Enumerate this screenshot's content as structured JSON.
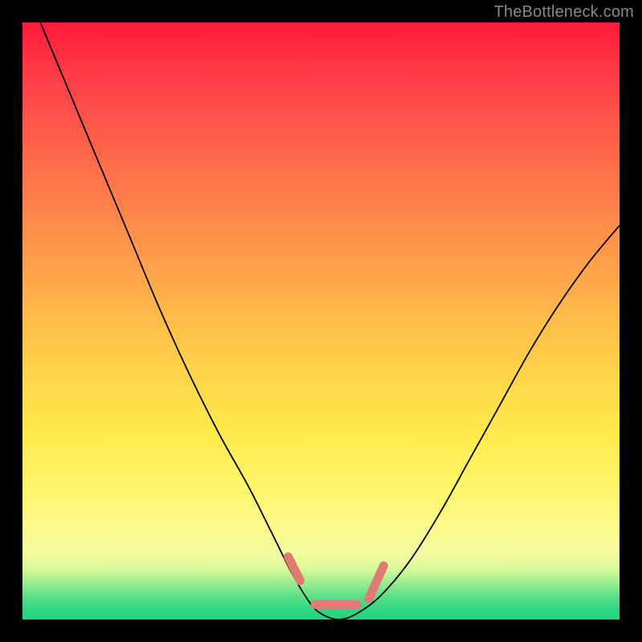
{
  "watermark": "TheBottleneck.com",
  "colors": {
    "gradient_top": "#ff1a3a",
    "gradient_mid": "#ffd24a",
    "gradient_bottom": "#22d482",
    "curve": "#000000",
    "trough_marker": "#e07a74",
    "frame": "#000000"
  },
  "chart_data": {
    "type": "line",
    "title": "",
    "xlabel": "",
    "ylabel": "",
    "xlim": [
      0,
      100
    ],
    "ylim": [
      0,
      100
    ],
    "x": [
      3,
      8,
      13,
      18,
      23,
      28,
      33,
      38,
      42,
      45,
      48,
      50,
      53,
      56,
      60,
      65,
      70,
      75,
      80,
      85,
      90,
      95,
      100
    ],
    "values": [
      100,
      88,
      76,
      64,
      52,
      41,
      31,
      22,
      14,
      8,
      3,
      1,
      0,
      1,
      4,
      10,
      18,
      27,
      36,
      45,
      53,
      60,
      66
    ],
    "trough_segments": [
      {
        "x0": 44.5,
        "y0": 10.5,
        "x1": 46.5,
        "y1": 6.5
      },
      {
        "x0": 49.0,
        "y0": 2.5,
        "x1": 56.0,
        "y1": 2.5
      },
      {
        "x0": 58.0,
        "y0": 3.5,
        "x1": 60.5,
        "y1": 9.0
      }
    ]
  }
}
